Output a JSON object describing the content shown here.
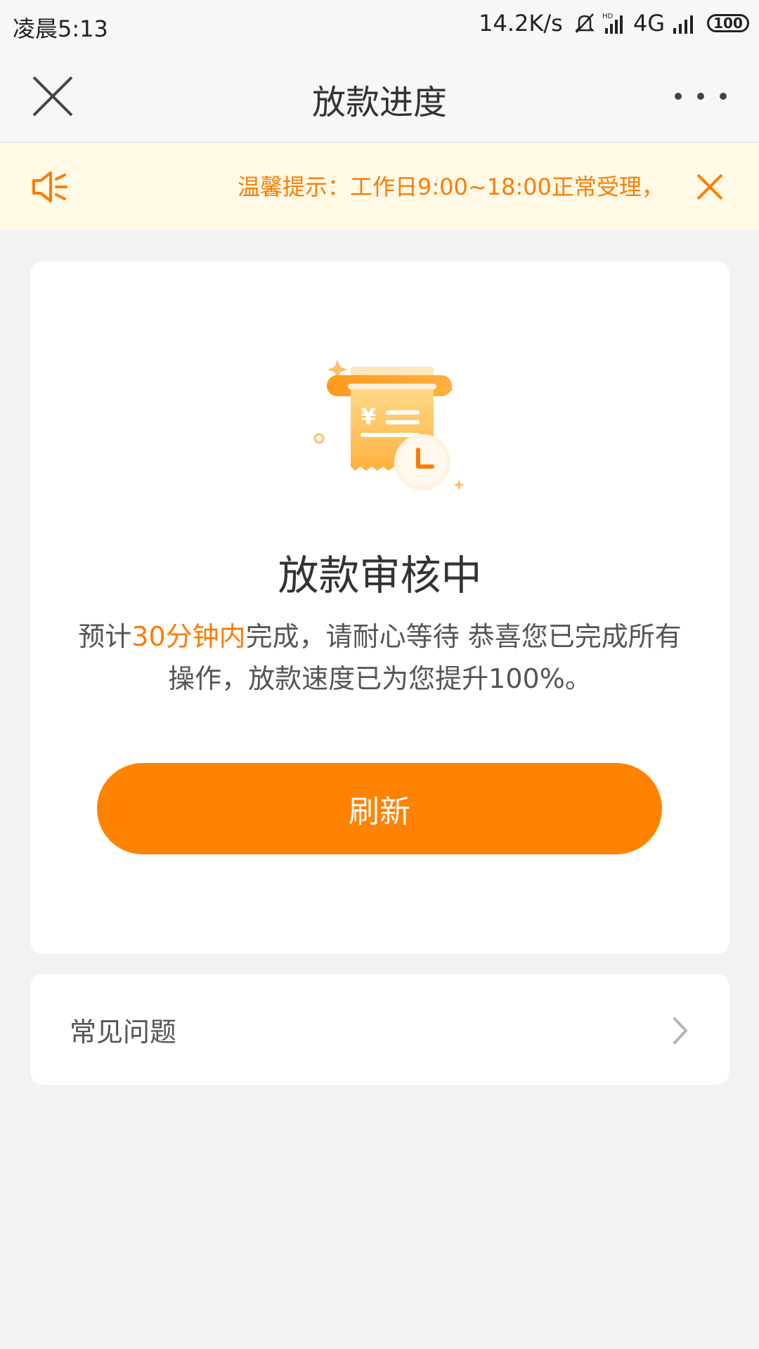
{
  "status_bar": {
    "time": "凌晨5:13",
    "net_speed": "14.2K/s",
    "network": "4G",
    "battery": "100",
    "icons": [
      "bell-muted-icon",
      "hd-signal-icon",
      "cell-signal-icon",
      "battery-icon"
    ]
  },
  "nav": {
    "title": "放款进度",
    "close_icon": "close-icon",
    "more_icon": "more-dots-icon"
  },
  "notice": {
    "text": "温馨提示：工作日9:00~18:00正常受理，",
    "icon": "speaker-icon",
    "close_icon": "close-icon"
  },
  "status_card": {
    "icon": "receipt-clock-icon",
    "title": "放款审核中",
    "desc_prefix": "预计",
    "desc_highlight": "30分钟内",
    "desc_suffix": "完成，请耐心等待 恭喜您已完成所有操作，放款速度已为您提升100%。",
    "button_label": "刷新"
  },
  "faq": {
    "label": "常见问题",
    "chevron_icon": "chevron-right-icon"
  },
  "colors": {
    "accent": "#ff8200",
    "notice_text": "#ff7c00",
    "notice_bg": "#fff9e6",
    "page_bg": "#f2f2f2"
  }
}
